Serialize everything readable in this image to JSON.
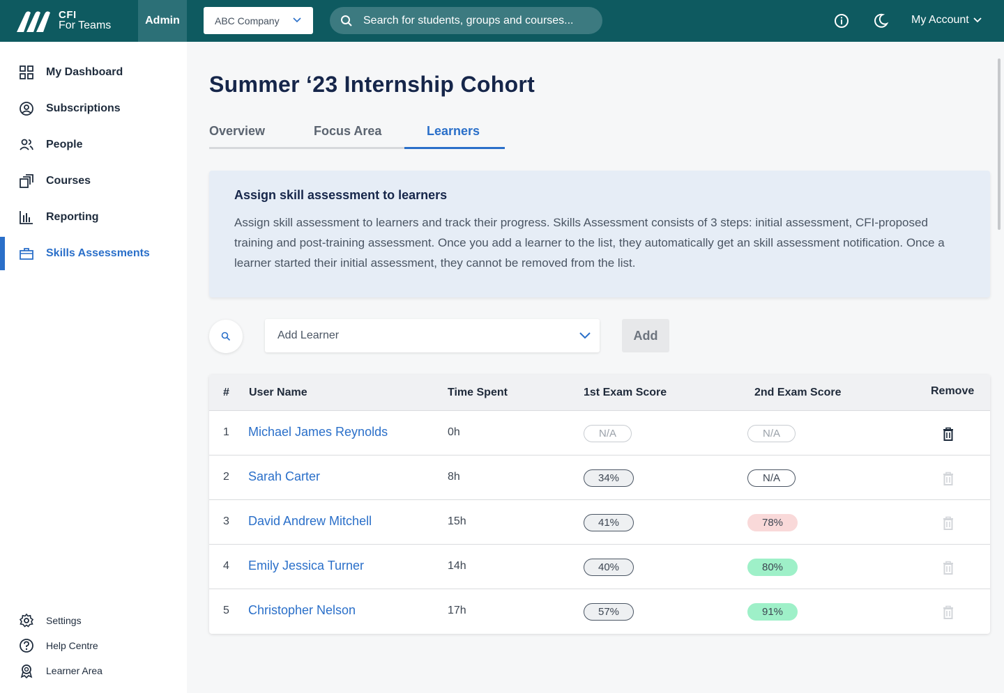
{
  "header": {
    "logo_line1": "CFI",
    "logo_line2": "For Teams",
    "admin_label": "Admin",
    "company_select": "ABC Company",
    "search_placeholder": "Search for students, groups and courses...",
    "account_label": "My Account",
    "icons": [
      "info-icon",
      "moon-icon",
      "chevron-down-icon"
    ]
  },
  "sidebar": {
    "items": [
      {
        "label": "My Dashboard",
        "icon": "dashboard-icon",
        "active": false
      },
      {
        "label": "Subscriptions",
        "icon": "user-circle-icon",
        "active": false
      },
      {
        "label": "People",
        "icon": "people-icon",
        "active": false
      },
      {
        "label": "Courses",
        "icon": "courses-icon",
        "active": false
      },
      {
        "label": "Reporting",
        "icon": "bar-chart-icon",
        "active": false
      },
      {
        "label": "Skills Assessments",
        "icon": "briefcase-icon",
        "active": true
      }
    ],
    "footer": [
      {
        "label": "Settings",
        "icon": "gear-icon"
      },
      {
        "label": "Help Centre",
        "icon": "help-icon"
      },
      {
        "label": "Learner Area",
        "icon": "badge-icon"
      }
    ]
  },
  "page": {
    "title": "Summer ‘23 Internship Cohort",
    "tabs": [
      {
        "label": "Overview",
        "active": false
      },
      {
        "label": "Focus Area",
        "active": false
      },
      {
        "label": "Learners",
        "active": true
      }
    ],
    "info": {
      "heading": "Assign skill assessment to learners",
      "body": "Assign skill assessment to learners and track their progress. Skills Assessment consists of 3 steps: initial assessment, CFI-proposed training and post-training assessment. Once you add a learner to the list, they automatically get an skill assessment notification. Once a learner started their initial assessment, they cannot be removed from the list."
    },
    "add_learner_placeholder": "Add Learner",
    "add_button": "Add"
  },
  "table": {
    "headers": [
      "#",
      "User Name",
      "Time Spent",
      "1st Exam Score",
      "2nd Exam Score",
      "Remove"
    ],
    "rows": [
      {
        "num": "1",
        "name": "Michael James Reynolds",
        "time": "0h",
        "exam1": "N/A",
        "exam1_style": "faint",
        "exam2": "N/A",
        "exam2_style": "faint",
        "removable": true
      },
      {
        "num": "2",
        "name": "Sarah Carter",
        "time": "8h",
        "exam1": "34%",
        "exam1_style": "neutral",
        "exam2": "N/A",
        "exam2_style": "outline",
        "removable": false
      },
      {
        "num": "3",
        "name": "David Andrew Mitchell",
        "time": "15h",
        "exam1": "41%",
        "exam1_style": "neutral",
        "exam2": "78%",
        "exam2_style": "red",
        "removable": false
      },
      {
        "num": "4",
        "name": "Emily Jessica Turner",
        "time": "14h",
        "exam1": "40%",
        "exam1_style": "neutral",
        "exam2": "80%",
        "exam2_style": "green",
        "removable": false
      },
      {
        "num": "5",
        "name": "Christopher Nelson",
        "time": "17h",
        "exam1": "57%",
        "exam1_style": "neutral",
        "exam2": "91%",
        "exam2_style": "green",
        "removable": false
      }
    ]
  },
  "colors": {
    "topbar": "#0e5a60",
    "accent": "#2a6fc9",
    "score_red": "#f9d9d9",
    "score_green": "#9ef0c8"
  }
}
